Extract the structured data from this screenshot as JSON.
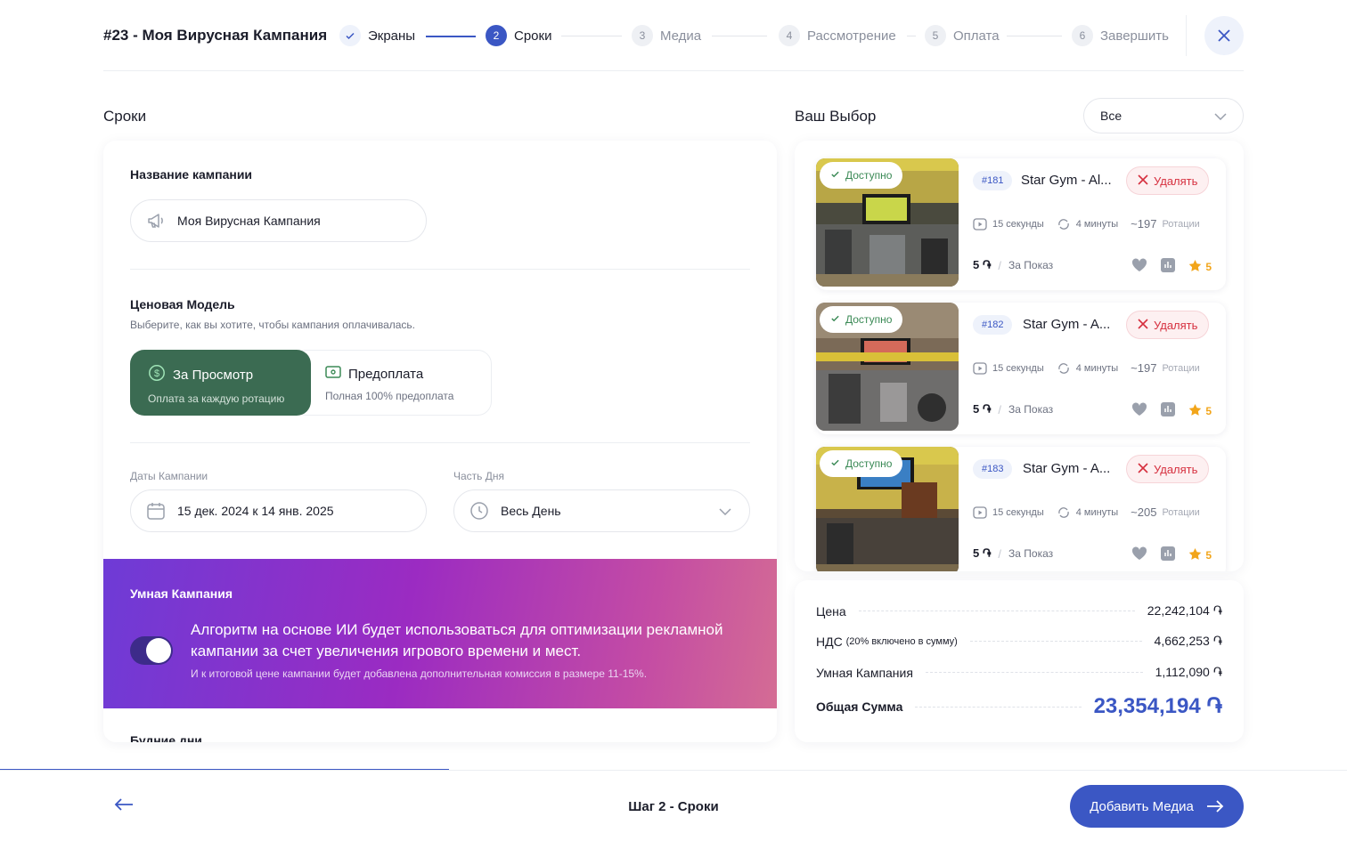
{
  "header": {
    "title": "#23 - Моя Вирусная Кампания",
    "steps": [
      {
        "num": "✓",
        "label": "Экраны",
        "state": "done"
      },
      {
        "num": "2",
        "label": "Сроки",
        "state": "active"
      },
      {
        "num": "3",
        "label": "Медиа",
        "state": "todo"
      },
      {
        "num": "4",
        "label": "Рассмотрение",
        "state": "todo"
      },
      {
        "num": "5",
        "label": "Оплата",
        "state": "todo"
      },
      {
        "num": "6",
        "label": "Завершить",
        "state": "todo"
      }
    ],
    "close_icon": "close-icon"
  },
  "left": {
    "section_title": "Сроки",
    "campaign_name_label": "Название кампании",
    "campaign_name_value": "Моя Вирусная Кампания",
    "pricing_label": "Ценовая Модель",
    "pricing_sub": "Выберите, как вы хотите, чтобы кампания оплачивалась.",
    "pricing_options": [
      {
        "title": "За Просмотр",
        "sub": "Оплата за каждую ротацию",
        "selected": true
      },
      {
        "title": "Предоплата",
        "sub": "Полная 100% предоплата",
        "selected": false
      }
    ],
    "dates_label": "Даты Кампании",
    "dates_from": "15 дек. 2024",
    "dates_sep": "к",
    "dates_to": "14 янв. 2025",
    "daypart_label": "Часть Дня",
    "daypart_value": "Весь День",
    "smart_title": "Умная Кампания",
    "smart_text": "Алгоритм на основе ИИ будет использоваться для оптимизации рекламной кампании за счет увеличения игрового времени и мест.",
    "smart_note": "И к итоговой цене кампании будет добавлена дополнительная комиссия в размере 11-15%.",
    "smart_enabled": true,
    "weekdays_label": "Будние дни"
  },
  "right": {
    "section_title": "Ваш Выбор",
    "filter_value": "Все",
    "screens": [
      {
        "badge": "Доступно",
        "id": "#181",
        "name": "Star Gym - Al...",
        "remove": "Удалять",
        "duration": "15 секунды",
        "interval": "4 минуты",
        "rotations": "~197",
        "rot_label": "Ротации",
        "price": "5",
        "currency": "֏",
        "per": "За Показ",
        "rating": "5"
      },
      {
        "badge": "Доступно",
        "id": "#182",
        "name": "Star Gym - A...",
        "remove": "Удалять",
        "duration": "15 секунды",
        "interval": "4 минуты",
        "rotations": "~197",
        "rot_label": "Ротации",
        "price": "5",
        "currency": "֏",
        "per": "За Показ",
        "rating": "5"
      },
      {
        "badge": "Доступно",
        "id": "#183",
        "name": "Star Gym - A...",
        "remove": "Удалять",
        "duration": "15 секунды",
        "interval": "4 минуты",
        "rotations": "~205",
        "rot_label": "Ротации",
        "price": "5",
        "currency": "֏",
        "per": "За Показ",
        "rating": "5"
      }
    ],
    "summary": {
      "price_label": "Цена",
      "price_value": "22,242,104 ֏",
      "vat_label": "НДС",
      "vat_note": "(20% включено в сумму)",
      "vat_value": "4,662,253 ֏",
      "smart_label": "Умная Кампания",
      "smart_value": "1,112,090 ֏",
      "total_label": "Общая Сумма",
      "total_value": "23,354,194 ֏"
    }
  },
  "footer": {
    "step_text": "Шаг 2 - Сроки",
    "next_label": "Добавить Медиа",
    "progress": 0.333
  },
  "colors": {
    "accent": "#3b57c4",
    "selected_green": "#3b6b52",
    "danger": "#d6303f",
    "star": "#f2a51a"
  }
}
